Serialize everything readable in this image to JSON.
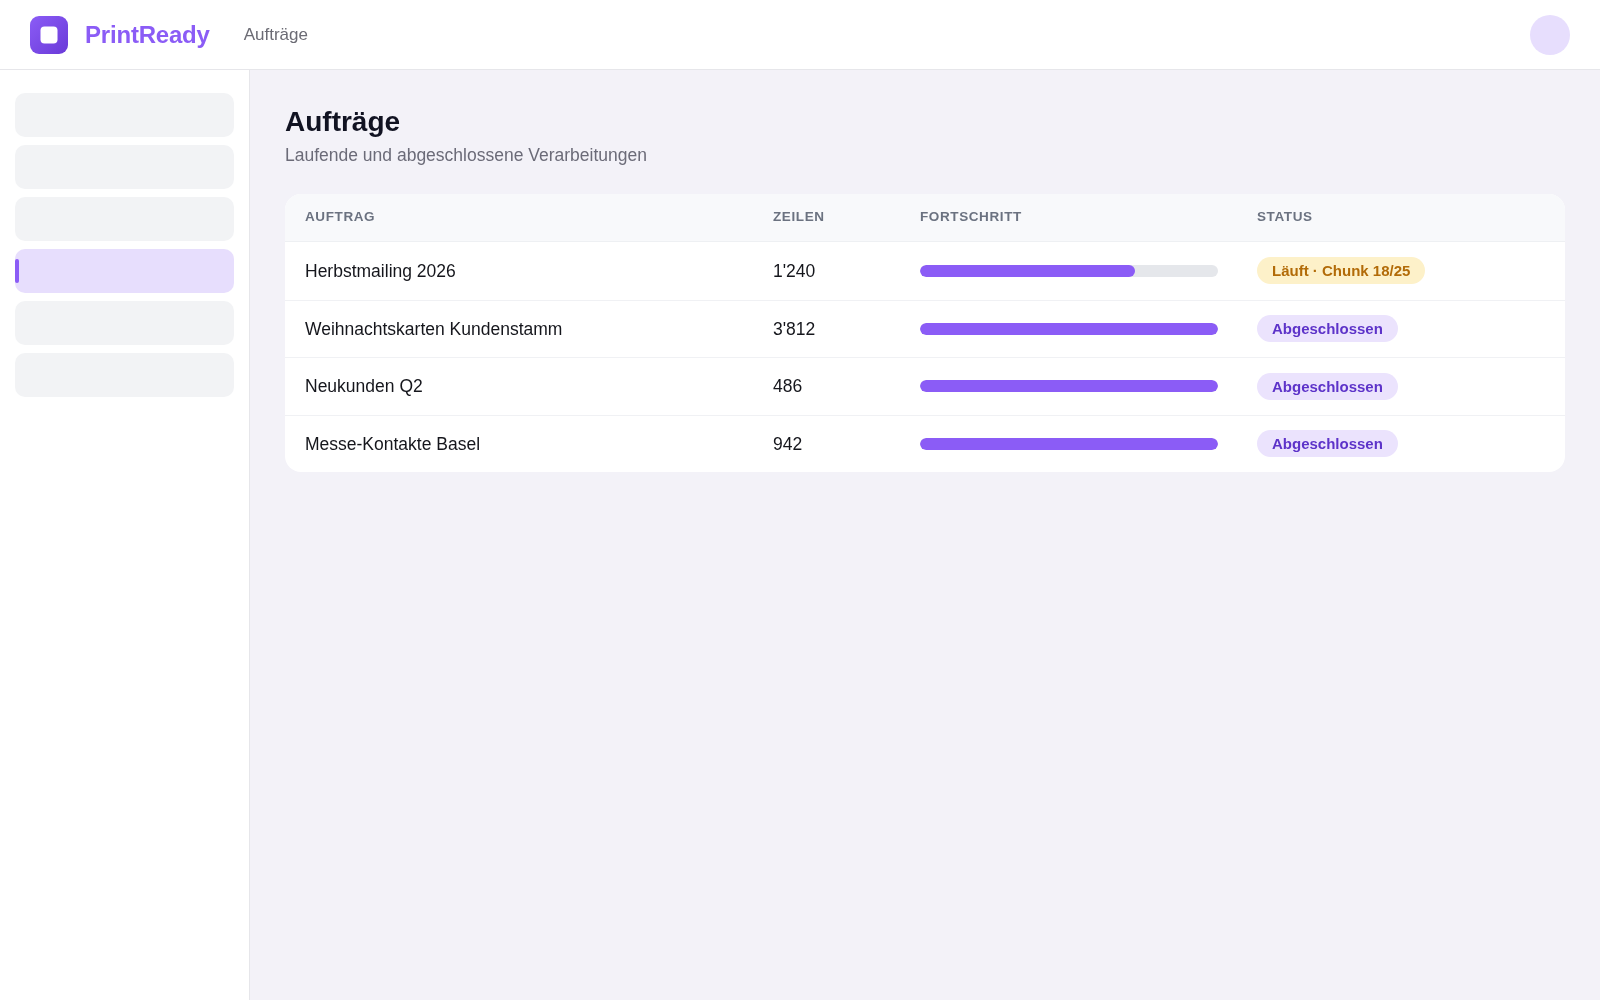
{
  "header": {
    "brand": "PrintReady",
    "nav": [
      {
        "label": "Aufträge"
      }
    ]
  },
  "sidebar": {
    "items": [
      {
        "selected": false
      },
      {
        "selected": false
      },
      {
        "selected": false
      },
      {
        "selected": true
      },
      {
        "selected": false
      },
      {
        "selected": false
      }
    ]
  },
  "page": {
    "title": "Aufträge",
    "subtitle": "Laufende und abgeschlossene Verarbeitungen"
  },
  "table": {
    "columns": [
      "AUFTRAG",
      "ZEILEN",
      "FORTSCHRITT",
      "STATUS"
    ],
    "rows": [
      {
        "auftrag": "Herbstmailing 2026",
        "zeilen": "1'240",
        "level": 0.72,
        "status": {
          "label": "Läuft · Chunk 18/25",
          "kind": "running"
        }
      },
      {
        "auftrag": "Weihnachtskarten Kundenstamm",
        "zeilen": "3'812",
        "level": 1,
        "status": {
          "label": "Abgeschlossen",
          "kind": "done"
        }
      },
      {
        "auftrag": "Neukunden Q2",
        "zeilen": "486",
        "level": 1,
        "status": {
          "label": "Abgeschlossen",
          "kind": "done"
        }
      },
      {
        "auftrag": "Messe-Kontakte Basel",
        "zeilen": "942",
        "level": 1,
        "status": {
          "label": "Abgeschlossen",
          "kind": "done"
        }
      }
    ]
  }
}
